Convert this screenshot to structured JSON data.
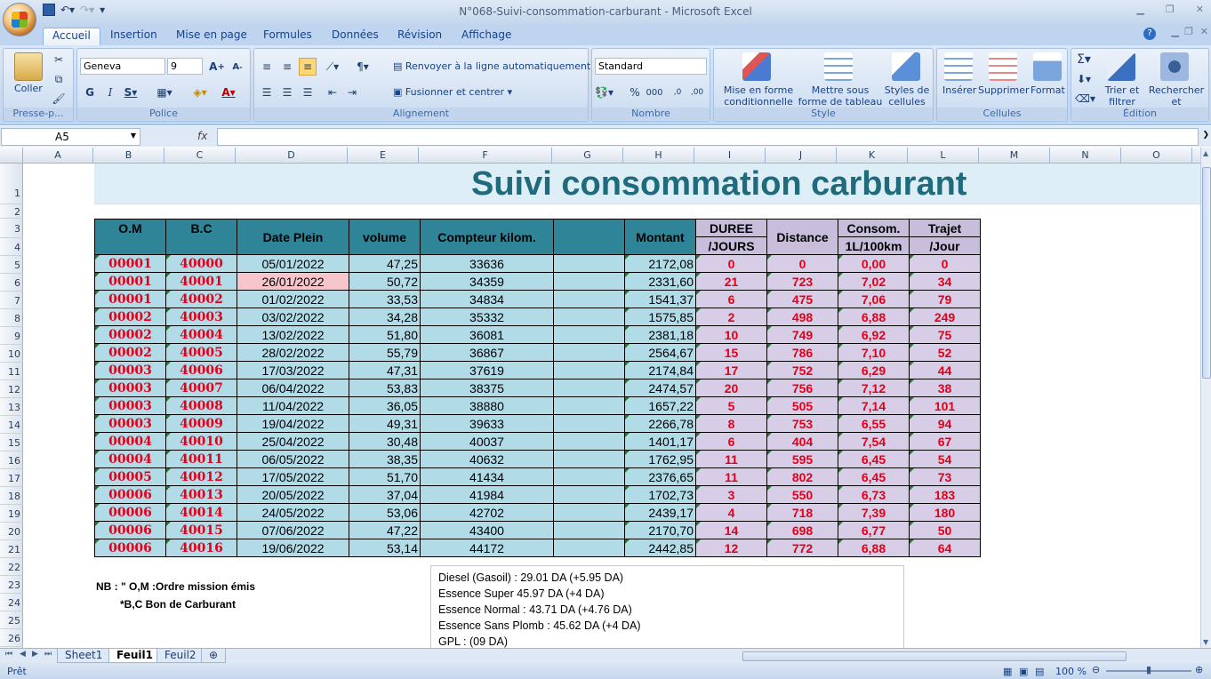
{
  "window": {
    "title": "N°068-Suivi-consommation-carburant - Microsoft Excel"
  },
  "tabs": [
    "Accueil",
    "Insertion",
    "Mise en page",
    "Formules",
    "Données",
    "Révision",
    "Affichage"
  ],
  "ribbon": {
    "clipboard": {
      "label": "Presse-p...",
      "paste": "Coller"
    },
    "font": {
      "label": "Police",
      "name": "Geneva",
      "size": "9"
    },
    "alignment": {
      "label": "Alignement",
      "wrap": "Renvoyer à la ligne automatiquement",
      "merge": "Fusionner et centrer"
    },
    "number": {
      "label": "Nombre",
      "format": "Standard"
    },
    "style": {
      "label": "Style",
      "cond": "Mise en forme conditionnelle",
      "table": "Mettre sous forme de tableau",
      "cellstyles": "Styles de cellules"
    },
    "cells": {
      "label": "Cellules",
      "insert": "Insérer",
      "delete": "Supprimer",
      "format": "Format"
    },
    "edit": {
      "label": "Édition",
      "sort": "Trier et filtrer",
      "find": "Rechercher et sélectionner"
    }
  },
  "formula": {
    "namebox": "A5",
    "fx": "fx"
  },
  "columns": [
    "A",
    "B",
    "C",
    "D",
    "E",
    "F",
    "G",
    "H",
    "I",
    "J",
    "K",
    "L",
    "M",
    "N",
    "O"
  ],
  "rows": [
    "1",
    "2",
    "3",
    "4",
    "5",
    "6",
    "7",
    "8",
    "9",
    "10",
    "11",
    "12",
    "13",
    "14",
    "15",
    "16",
    "17",
    "18",
    "19",
    "20",
    "21",
    "22",
    "23",
    "24",
    "25",
    "26"
  ],
  "sheet": {
    "title": "Suivi consommation carburant",
    "headers": {
      "om": "O.M",
      "bc": "B.C",
      "date": "Date Plein",
      "volume": "volume",
      "compteur": "Compteur kilom.",
      "montant": "Montant",
      "duree": "DUREE",
      "duree_sub": "/JOURS",
      "distance": "Distance",
      "consom": "Consom.",
      "consom_sub": "1L/100km",
      "trajet": "Trajet",
      "trajet_sub": "/Jour"
    },
    "data": [
      [
        "00001",
        "40000",
        "05/01/2022",
        "47,25",
        "33636",
        "2172,08",
        "0",
        "0",
        "0,00",
        "0"
      ],
      [
        "00001",
        "40001",
        "26/01/2022",
        "50,72",
        "34359",
        "2331,60",
        "21",
        "723",
        "7,02",
        "34"
      ],
      [
        "00001",
        "40002",
        "01/02/2022",
        "33,53",
        "34834",
        "1541,37",
        "6",
        "475",
        "7,06",
        "79"
      ],
      [
        "00002",
        "40003",
        "03/02/2022",
        "34,28",
        "35332",
        "1575,85",
        "2",
        "498",
        "6,88",
        "249"
      ],
      [
        "00002",
        "40004",
        "13/02/2022",
        "51,80",
        "36081",
        "2381,18",
        "10",
        "749",
        "6,92",
        "75"
      ],
      [
        "00002",
        "40005",
        "28/02/2022",
        "55,79",
        "36867",
        "2564,67",
        "15",
        "786",
        "7,10",
        "52"
      ],
      [
        "00003",
        "40006",
        "17/03/2022",
        "47,31",
        "37619",
        "2174,84",
        "17",
        "752",
        "6,29",
        "44"
      ],
      [
        "00003",
        "40007",
        "06/04/2022",
        "53,83",
        "38375",
        "2474,57",
        "20",
        "756",
        "7,12",
        "38"
      ],
      [
        "00003",
        "40008",
        "11/04/2022",
        "36,05",
        "38880",
        "1657,22",
        "5",
        "505",
        "7,14",
        "101"
      ],
      [
        "00003",
        "40009",
        "19/04/2022",
        "49,31",
        "39633",
        "2266,78",
        "8",
        "753",
        "6,55",
        "94"
      ],
      [
        "00004",
        "40010",
        "25/04/2022",
        "30,48",
        "40037",
        "1401,17",
        "6",
        "404",
        "7,54",
        "67"
      ],
      [
        "00004",
        "40011",
        "06/05/2022",
        "38,35",
        "40632",
        "1762,95",
        "11",
        "595",
        "6,45",
        "54"
      ],
      [
        "00005",
        "40012",
        "17/05/2022",
        "51,70",
        "41434",
        "2376,65",
        "11",
        "802",
        "6,45",
        "73"
      ],
      [
        "00006",
        "40013",
        "20/05/2022",
        "37,04",
        "41984",
        "1702,73",
        "3",
        "550",
        "6,73",
        "183"
      ],
      [
        "00006",
        "40014",
        "24/05/2022",
        "53,06",
        "42702",
        "2439,17",
        "4",
        "718",
        "7,39",
        "180"
      ],
      [
        "00006",
        "40015",
        "07/06/2022",
        "47,22",
        "43400",
        "2170,70",
        "14",
        "698",
        "6,77",
        "50"
      ],
      [
        "00006",
        "40016",
        "19/06/2022",
        "53,14",
        "44172",
        "2442,85",
        "12",
        "772",
        "6,88",
        "64"
      ]
    ],
    "notes": {
      "line1": "NB : \" O,M :Ordre mission émis",
      "line2": "*B,C    Bon de Carburant"
    },
    "fuel": [
      "Diesel (Gasoil) : 29.01  DA (+5.95 DA)",
      "Essence Super 45.97 DA (+4 DA)",
      "Essence Normal : 43.71  DA (+4.76 DA)",
      "Essence Sans Plomb : 45.62 DA (+4 DA)",
      "GPL : (09 DA)"
    ]
  },
  "sheettabs": [
    "Sheet1",
    "Feuil1",
    "Feuil2"
  ],
  "status": {
    "ready": "Prêt",
    "zoom": "100 %"
  }
}
